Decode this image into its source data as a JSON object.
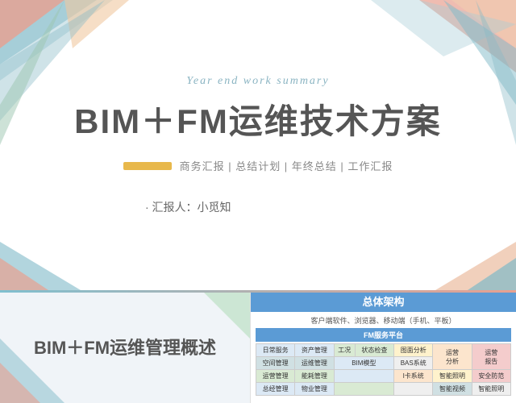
{
  "slide": {
    "year_end_label": "Year end work summary",
    "main_title": "BIM＋FM运维技术方案",
    "subtitle_text": "商务汇报 | 总结计划 | 年终总结 | 工作汇报",
    "reporter_label": "· 汇报人：小觅知"
  },
  "bottom_left": {
    "title": "BIM＋FM运维管理概述"
  },
  "bottom_right": {
    "header": "总体架构",
    "platform_row": "客户端软件、浏览器、移动端（手机、平板）",
    "fm_platform": "FM服务平台",
    "grid": {
      "row1": [
        "日常服务",
        "资产管理",
        "工况",
        "状态检查",
        "图面分析",
        "运营分析"
      ],
      "row1_extra": "运营分析",
      "row2": [
        "空间管理",
        "运维管理",
        "BIM模型",
        "BAS系统",
        "安全防范"
      ],
      "row3": [
        "运营管理",
        "能耗管理",
        "",
        "I卡系统",
        "智能照明"
      ],
      "row4": [
        "总经管理",
        "物业管理",
        "",
        "",
        "智能视频"
      ]
    }
  }
}
